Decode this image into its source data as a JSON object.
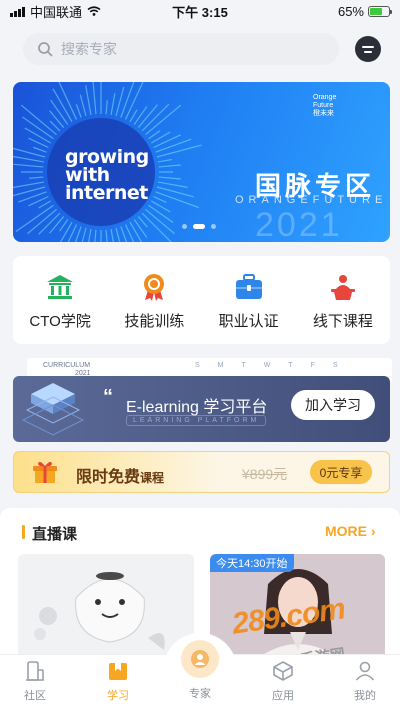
{
  "status": {
    "carrier": "中国联通",
    "time": "下午 3:15",
    "battery": "65%"
  },
  "search": {
    "placeholder": "搜索专家"
  },
  "banner": {
    "left_text": [
      "growing",
      "with",
      "internet"
    ],
    "year": "2021",
    "title": "国脉专区",
    "subtitle": "ORANGEFUTURE",
    "logo": [
      "Orange",
      "Future",
      "橙未来"
    ]
  },
  "categories": [
    {
      "label": "CTO学院",
      "icon": "bank-icon",
      "color": "#24b35c"
    },
    {
      "label": "技能训练",
      "icon": "medal-icon",
      "color": "#f08a1c"
    },
    {
      "label": "职业认证",
      "icon": "briefcase-icon",
      "color": "#2f86e8"
    },
    {
      "label": "线下课程",
      "icon": "podium-icon",
      "color": "#e8453c"
    }
  ],
  "elearning": {
    "curriculum": "CURRICULUM",
    "year": "2021",
    "days": [
      "S",
      "M",
      "T",
      "W",
      "T",
      "F",
      "S"
    ],
    "title": "E-learning 学习平台",
    "sub": "LEARNING PLATFORM",
    "button": "加入学习"
  },
  "free": {
    "title": "限时免费",
    "suffix": "课程",
    "price": "¥899元",
    "button": "0元专享"
  },
  "live": {
    "title": "直播课",
    "more": "MORE",
    "badge": "今天14:30开始"
  },
  "watermark": {
    "brand": "289.com",
    "sub": "手游网"
  },
  "tabs": [
    {
      "label": "社区",
      "icon": "community-icon"
    },
    {
      "label": "学习",
      "icon": "book-icon",
      "active": true
    },
    {
      "label": "专家",
      "icon": "expert-icon"
    },
    {
      "label": "应用",
      "icon": "app-icon"
    },
    {
      "label": "我的",
      "icon": "profile-icon"
    }
  ],
  "colors": {
    "accent": "#f5a623",
    "banner": "#1f6ff0",
    "elearning": "#4b5883"
  }
}
